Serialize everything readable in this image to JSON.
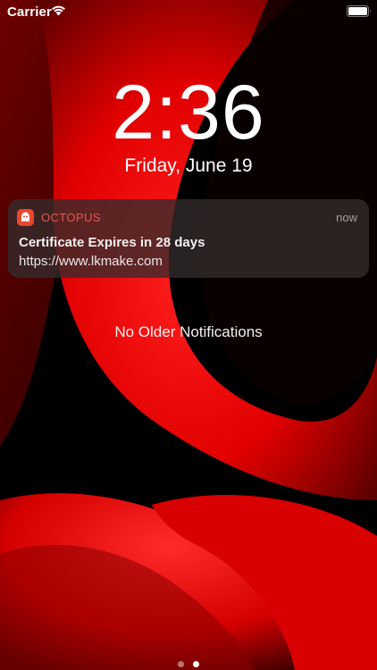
{
  "status_bar": {
    "carrier": "Carrier",
    "wifi_icon": "wifi-icon",
    "battery_icon": "battery-full-icon"
  },
  "lock_screen": {
    "time": "2:36",
    "date": "Friday, June 19"
  },
  "notification": {
    "app_icon": "octopus-icon",
    "app_name": "OCTOPUS",
    "time": "now",
    "title": "Certificate Expires in 28 days",
    "body": "https://www.lkmake.com",
    "accent_color": "#e8462e"
  },
  "notification_center": {
    "empty_message": "No Older Notifications"
  },
  "pager": {
    "page_count": 2,
    "current_page": 2
  },
  "colors": {
    "background": "#000000",
    "wallpaper_red": "#ff1a1a"
  }
}
